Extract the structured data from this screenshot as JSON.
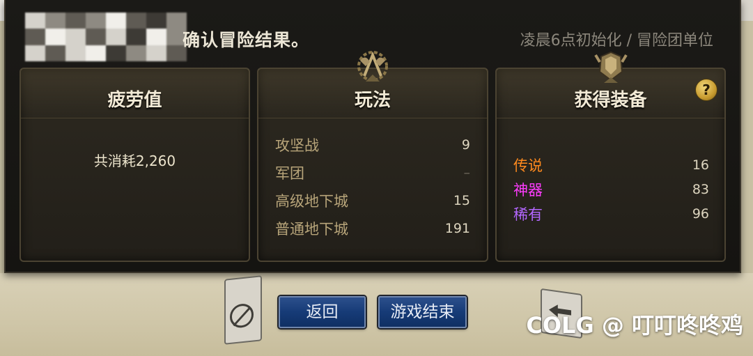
{
  "dialog": {
    "title": "确认冒险结果。",
    "reset_info": "凌晨6点初始化 / 冒险团单位"
  },
  "fatigue": {
    "title": "疲劳值",
    "consumed": "共消耗2,260"
  },
  "play": {
    "title": "玩法",
    "rows": [
      {
        "label": "攻坚战",
        "value": "9"
      },
      {
        "label": "军团",
        "value": "–"
      },
      {
        "label": "高级地下城",
        "value": "15"
      },
      {
        "label": "普通地下城",
        "value": "191"
      }
    ]
  },
  "gear": {
    "title": "获得装备",
    "help": "?",
    "rows": [
      {
        "label": "传说",
        "value": "16",
        "color": "#ff8a1e"
      },
      {
        "label": "神器",
        "value": "83",
        "color": "#ff3cff"
      },
      {
        "label": "稀有",
        "value": "96",
        "color": "#b367ff"
      }
    ]
  },
  "buttons": {
    "back": "返回",
    "end_game": "游戏结束"
  },
  "watermark": "COLG @ 叮叮咚咚鸡"
}
